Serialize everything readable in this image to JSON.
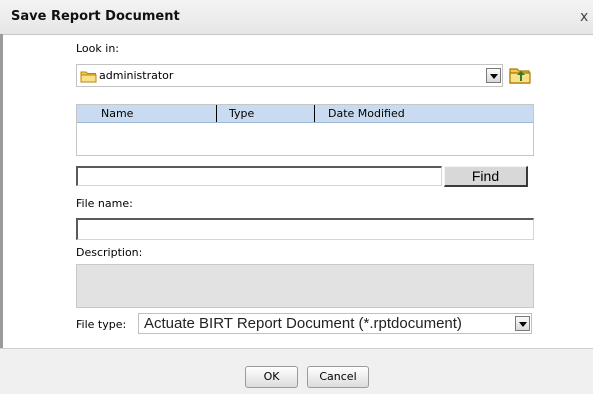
{
  "dialog": {
    "title": "Save Report Document",
    "close_label": "x"
  },
  "look_in": {
    "label": "Look in:",
    "value": "administrator"
  },
  "file_list": {
    "columns": [
      "Name",
      "Type",
      "Date Modified"
    ],
    "rows": []
  },
  "search": {
    "value": "",
    "find_label": "Find"
  },
  "file_name": {
    "label": "File name:",
    "value": ""
  },
  "description": {
    "label": "Description:",
    "value": ""
  },
  "file_type": {
    "label": "File type:",
    "value": "Actuate BIRT Report Document (*.rptdocument)"
  },
  "buttons": {
    "ok": "OK",
    "cancel": "Cancel"
  },
  "icons": {
    "look_in": "folder-icon",
    "up": "up-folder-icon"
  },
  "colors": {
    "list_header": "#c9dbf0",
    "folder": "#f2c94c"
  }
}
